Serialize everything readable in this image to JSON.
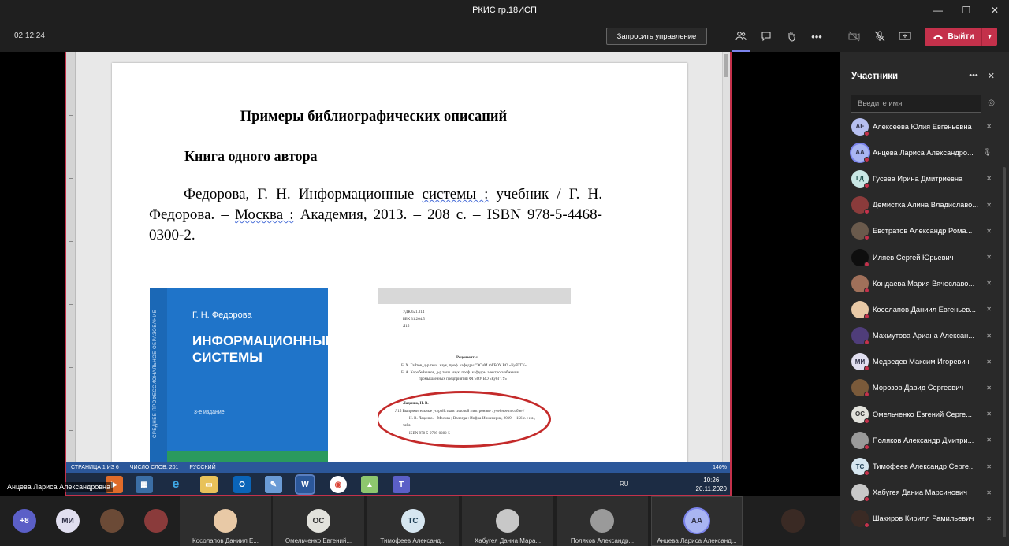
{
  "window": {
    "title": "РКИС гр.18ИСП",
    "controls": [
      "—",
      "❐",
      "✕"
    ]
  },
  "toolbar": {
    "timer": "02:12:24",
    "request_control_label": "Запросить управление",
    "leave_label": "Выйти",
    "icons": [
      "participants-icon",
      "chat-icon",
      "raise-hand-icon",
      "more-icon",
      "camera-off-icon",
      "mic-off-icon",
      "share-icon"
    ]
  },
  "document": {
    "heading": "Примеры библиографических описаний",
    "subheading": "Книга одного автора",
    "para_part1": "Федорова, Г. Н. Информационные ",
    "para_u1": "системы :",
    "para_part2": " учебник / Г. Н. Федорова. – ",
    "para_u2": "Москва :",
    "para_part3": " Академия, 2013. – 208 с. – ISBN 978-5-4468-0300-2.",
    "book": {
      "author": "Г. Н. Федорова",
      "title_line1": "ИНФОРМАЦИОННЫЕ",
      "title_line2": "СИСТЕМЫ",
      "edition": "3-е издание",
      "spine": "СРЕДНЕЕ ПРОФЕССИОНАЛЬНОЕ ОБРАЗОВАНИЕ"
    },
    "scan": {
      "udk": "УДК 621.314",
      "bbk": "ББК 31.264.5",
      "code": "Л15",
      "reviewers": "Рецензенты:",
      "rev1": "Б. Х. Гайтов, д-р техн. наук, проф. кафедры \"ЭСиМ ФГБОУ ВО «КубГТУ»;",
      "rev2": "Б. А. Коробейников, д-р техн. наук, проф. кафедры электроснабжения",
      "rev3": "промышленных предприятий ФГБОУ ВО «КубГТУ»",
      "author": "Ладенко, Н. В.",
      "l1": "Л15     Выпрямительные устройства в силовой электронике : учебное пособие /",
      "l2": "Н. В. Ладенко. – Москва ; Вологда : Инфра-Инженерия, 2019. – 156 с. : ил.,",
      "l3": "табл.",
      "l4": "ISBN 978-5-9729-0282-5"
    },
    "statusbar": {
      "page": "СТРАНИЦА 1 ИЗ 6",
      "words": "ЧИСЛО СЛОВ: 201",
      "lang": "РУССКИЙ",
      "zoom": "140%"
    },
    "tray": {
      "lang": "RU",
      "time": "10:26",
      "date": "20.11.2020"
    },
    "presenter": "Анцева Лариса Александровна"
  },
  "participants_panel": {
    "title": "Участники",
    "search_placeholder": "Введите имя",
    "items": [
      {
        "initials": "АЕ",
        "name": "Алексеева Юлия Евгеньевна",
        "color": "#b6bff0",
        "text": "#33344a"
      },
      {
        "initials": "АА",
        "name": "Анцева Лариса Александро...",
        "color": "#a9b5f2",
        "text": "#33344a",
        "speaking": true
      },
      {
        "initials": "ГД",
        "name": "Гусева Ирина Дмитриевна",
        "color": "#c9e7e5",
        "text": "#1d4f4b"
      },
      {
        "initials": "",
        "name": "Демистка Алина Владиславо...",
        "color": "#8a3b3b",
        "text": "#fff"
      },
      {
        "initials": "",
        "name": "Евстратов Александр Рома...",
        "color": "#6a5a4c",
        "text": "#fff"
      },
      {
        "initials": "",
        "name": "Иляев Сергей Юрьевич",
        "color": "#0e0e0e",
        "text": "#fff"
      },
      {
        "initials": "",
        "name": "Кондаева Мария Вячеславо...",
        "color": "#a0705a",
        "text": "#fff"
      },
      {
        "initials": "",
        "name": "Косолапов Даниил Евгеньев...",
        "color": "#e8c9a6",
        "text": "#333"
      },
      {
        "initials": "",
        "name": "Махмутова Ариана Алексан...",
        "color": "#4f3d7a",
        "text": "#fff"
      },
      {
        "initials": "МИ",
        "name": "Медведев Максим Игоревич",
        "color": "#e1dff0",
        "text": "#33344a"
      },
      {
        "initials": "",
        "name": "Морозов Давид Сергеевич",
        "color": "#7a5a3a",
        "text": "#fff"
      },
      {
        "initials": "ОС",
        "name": "Омельченко Евгений Серге...",
        "color": "#e2e2dc",
        "text": "#333"
      },
      {
        "initials": "",
        "name": "Поляков Александр Дмитри...",
        "color": "#9a9a9a",
        "text": "#fff"
      },
      {
        "initials": "ТС",
        "name": "Тимофеев Александр Серге...",
        "color": "#d6e6f0",
        "text": "#1f3f55"
      },
      {
        "initials": "",
        "name": "Хабугея Даниа Марсинович",
        "color": "#c8c8c8",
        "text": "#333"
      },
      {
        "initials": "",
        "name": "Шакиров Кирилл Рамильевич",
        "color": "#3a2a24",
        "text": "#fff"
      }
    ]
  },
  "gallery": {
    "more_label": "+8",
    "tiles": [
      {
        "initials": "МИ",
        "color": "#e1dff0",
        "text": "#33344a",
        "label": ""
      },
      {
        "initials": "",
        "color": "#6b4a36",
        "text": "#fff",
        "label": ""
      },
      {
        "initials": "",
        "color": "#8a3b3b",
        "text": "#fff",
        "label": ""
      },
      {
        "initials": "",
        "color": "#e8c9a6",
        "text": "#333",
        "label": "Косолапов Даниил Е..."
      },
      {
        "initials": "ОС",
        "color": "#e2e2dc",
        "text": "#333",
        "label": "Омельченко Евгений..."
      },
      {
        "initials": "ТС",
        "color": "#d6e6f0",
        "text": "#1f3f55",
        "label": "Тимофеев Александ..."
      },
      {
        "initials": "",
        "color": "#c8c8c8",
        "text": "#333",
        "label": "Хабугея Даниа Мара..."
      },
      {
        "initials": "",
        "color": "#9a9a9a",
        "text": "#fff",
        "label": "Поляков Александр..."
      },
      {
        "initials": "АА",
        "color": "#a9b5f2",
        "text": "#33344a",
        "label": "Анцева Лариса Александ..."
      },
      {
        "initials": "",
        "color": "#3a2a24",
        "text": "#fff",
        "label": ""
      }
    ]
  }
}
